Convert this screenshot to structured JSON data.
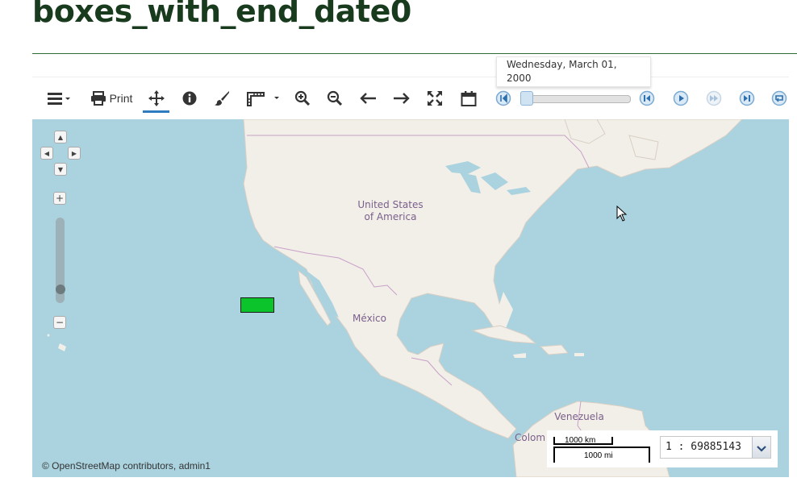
{
  "page": {
    "title": "boxes_with_end_date0"
  },
  "toolbar": {
    "print_label": "Print",
    "icons": [
      "menu-icon",
      "print-icon",
      "pan-icon",
      "info-icon",
      "paint-icon",
      "measure-icon",
      "zoom-in-icon",
      "zoom-out-icon",
      "back-icon",
      "forward-icon",
      "full-extent-icon",
      "calendar-icon"
    ],
    "time_controls": [
      "slider-start-icon",
      "step-back-icon",
      "play-icon",
      "fast-forward-icon",
      "skip-end-icon",
      "loop-icon"
    ]
  },
  "time_slider": {
    "tooltip": "Wednesday, March 01,\n2000"
  },
  "map": {
    "labels": {
      "usa": "United States\nof America",
      "mexico": "México",
      "venezuela": "Venezuela",
      "colombia": "Colom"
    },
    "attribution": "© OpenStreetMap contributors, admin1",
    "scale": {
      "km": "1000 km",
      "mi": "1000 mi",
      "ratio": "1 : 69885143"
    },
    "colors": {
      "water": "#aad3df",
      "land": "#f2efe9",
      "feature": "#0bc32a",
      "accent": "#2e7bc0",
      "title": "#183a1d"
    }
  }
}
